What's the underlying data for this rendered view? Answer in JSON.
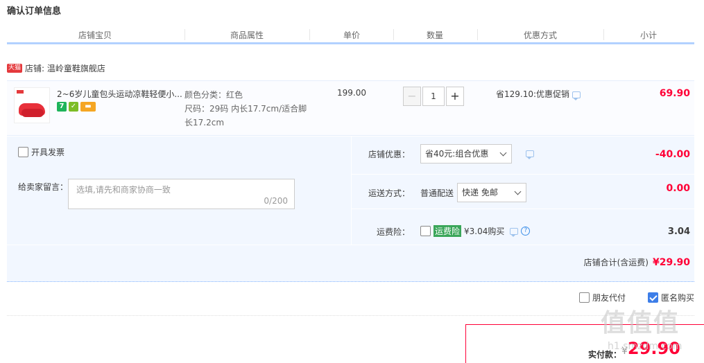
{
  "page": {
    "title": "确认订单信息"
  },
  "columns": [
    "店铺宝贝",
    "商品属性",
    "单价",
    "数量",
    "优惠方式",
    "小计"
  ],
  "shop": {
    "badge": "天猫",
    "label": "店铺: 温岭童鞋旗舰店"
  },
  "item": {
    "title": "2~6岁儿童包头运动凉鞋轻便小...",
    "badges": [
      "7",
      "✓",
      "▬"
    ],
    "attr_color": "颜色分类：红色",
    "attr_size_1": "尺码：29码 内长17.7cm/适合脚",
    "attr_size_2": "长17.2cm",
    "price": "199.00",
    "qty_minus": "−",
    "qty": "1",
    "qty_plus": "+",
    "promo": "省129.10:优惠促销",
    "subtotal": "69.90"
  },
  "extras": {
    "invoice_label": "开具发票",
    "message_label": "给卖家留言：",
    "message_placeholder": "选填,请先和商家协商一致",
    "message_count": "0/200",
    "shop_discount_label": "店铺优惠：",
    "shop_discount_value": "省40元:组合优惠",
    "shop_discount_amount": "-40.00",
    "shipping_label": "运送方式：",
    "shipping_method": "普通配送",
    "shipping_value": "快递 免邮",
    "shipping_amount": "0.00",
    "insurance_label": "运费险：",
    "insurance_tag": "运费险",
    "insurance_text": "¥3.04购买",
    "insurance_amount": "3.04",
    "shop_total_label": "店铺合计(含运费)",
    "shop_total_value": "¥29.90"
  },
  "options": {
    "friend_pay": "朋友代付",
    "anonymous": "匿名购买"
  },
  "payment": {
    "label": "实付款：",
    "currency": "¥",
    "value": "29.90"
  },
  "watermark": {
    "big": "值值值",
    "small": "h1.smzdm.com"
  },
  "colors": {
    "accent": "#ff0036",
    "header_line": "#b2d1ff",
    "panel_bg": "#f2f7ff"
  }
}
